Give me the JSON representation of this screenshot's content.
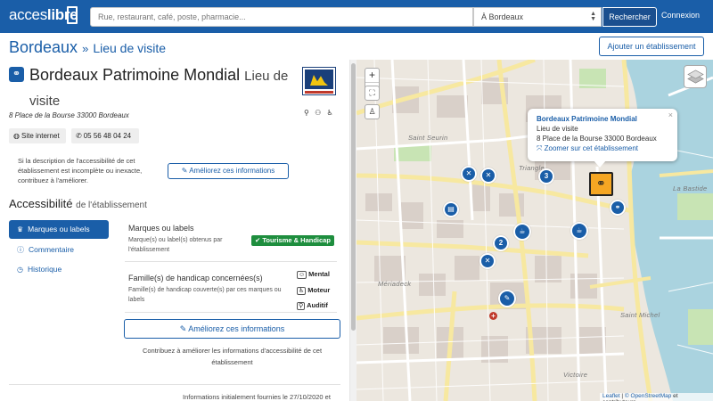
{
  "header": {
    "logo_prefix": "acces",
    "logo_suffix": "libre",
    "search_placeholder": "Rue, restaurant, café, poste, pharmacie...",
    "city_value": "À Bordeaux",
    "search_button": "Rechercher",
    "login": "Connexion",
    "brand_color": "#1a5ea8"
  },
  "breadcrumb": {
    "city": "Bordeaux",
    "separator": "»",
    "category": "Lieu de visite"
  },
  "add_button": "Ajouter un établissement",
  "place": {
    "name": "Bordeaux Patrimoine Mondial",
    "category": "Lieu de visite",
    "address": "8 Place de la Bourse 33000 Bordeaux",
    "website_label": "Site internet",
    "phone": "05 56 48 04 24",
    "incomplete_note": "Si la description de l'accessibilité de cet établissement est incomplète ou inexacte, contribuez à l'améliorer.",
    "improve_button": "Améliorez ces informations",
    "handicap_icons": "⚲ ⚇ ♿"
  },
  "accessibility": {
    "title": "Accessibilité",
    "subtitle": "de l'établissement",
    "nav": [
      {
        "label": "Marques ou labels",
        "icon": "trophy-icon"
      },
      {
        "label": "Commentaire",
        "icon": "info-icon"
      },
      {
        "label": "Historique",
        "icon": "clock-icon"
      }
    ],
    "labels_title": "Marques ou labels",
    "labels_desc": "Marque(s) ou label(s) obtenus par l'établissement",
    "label_badge": "✔ Tourisme & Handicap",
    "families_title": "Famille(s) de handicap concernées(s)",
    "families_desc": "Famille(s) de handicap couverte(s) par ces marques ou labels",
    "families": [
      "Mental",
      "Moteur",
      "Auditif"
    ],
    "improve_main": "Améliorez ces informations",
    "contrib_text": "Contribuez à améliorer les informations d'accessibilité de cet établissement",
    "info_date": "Informations initialement fournies le 27/10/2020 et"
  },
  "map": {
    "popup_title": "Bordeaux Patrimoine Mondial",
    "popup_category": "Lieu de visite",
    "popup_address": "8 Place de la Bourse 33000 Bordeaux",
    "popup_zoom": "Zoomer sur cet établissement",
    "popup_close": "×",
    "zoom_in": "+",
    "zoom_out": "−",
    "cluster_counts": [
      "3",
      "2"
    ],
    "attribution_leaflet": "Leaflet",
    "attribution_sep": "|",
    "attribution_osm": "© OpenStreetMap",
    "attribution_rest": "et contributeurs",
    "place_labels": {
      "saint_seurin": "Saint Seurin",
      "triangle": "Triangle",
      "saint_michel": "Saint Michel",
      "victoire": "Victoire",
      "mériadeck": "Mériadeck",
      "bastide": "La Bastide"
    },
    "marker_color": "#1a5ea8",
    "active_marker_color": "#f5a623",
    "water_color": "#aad3df"
  }
}
